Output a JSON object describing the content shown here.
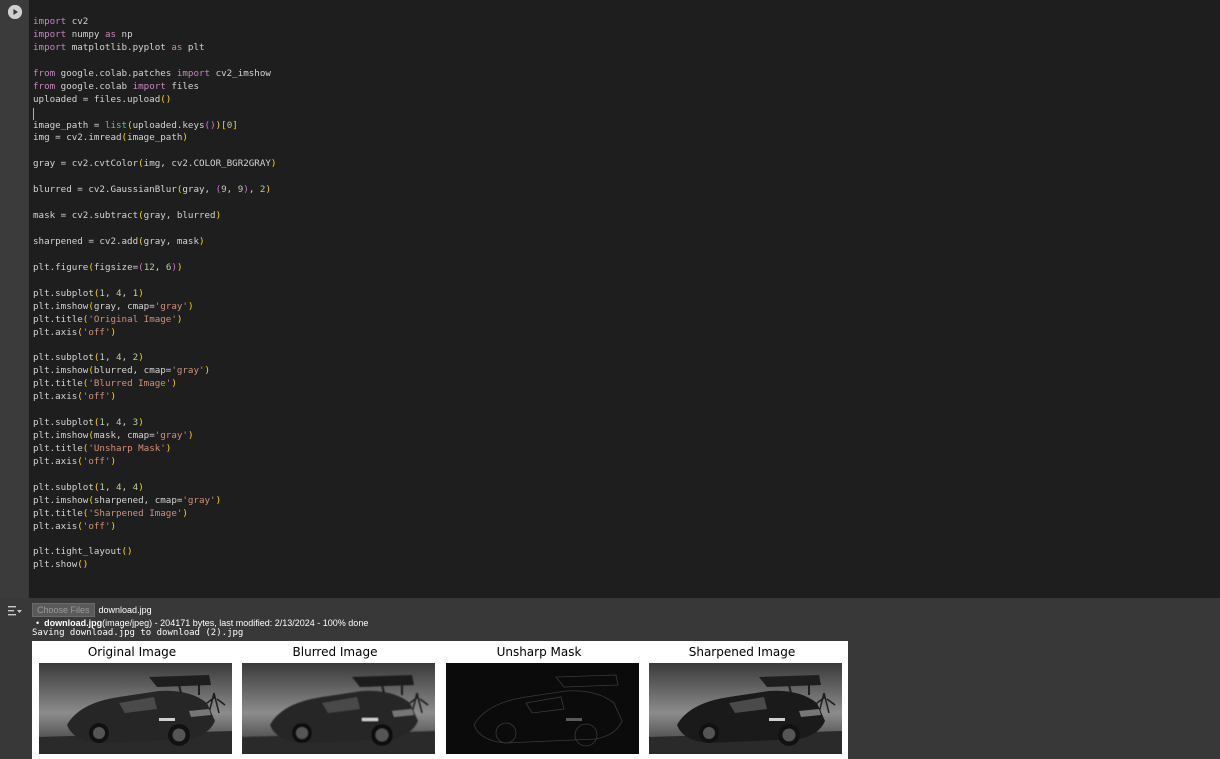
{
  "code_lines": [
    [
      {
        "t": "import",
        "c": "kw"
      },
      {
        "t": " cv2"
      }
    ],
    [
      {
        "t": "import",
        "c": "kw"
      },
      {
        "t": " numpy "
      },
      {
        "t": "as",
        "c": "kw"
      },
      {
        "t": " np"
      }
    ],
    [
      {
        "t": "import",
        "c": "kw"
      },
      {
        "t": " matplotlib.pyplot "
      },
      {
        "t": "as",
        "c": "kw"
      },
      {
        "t": " plt"
      }
    ],
    [],
    [
      {
        "t": "from",
        "c": "kw"
      },
      {
        "t": " google.colab.patches "
      },
      {
        "t": "import",
        "c": "kw"
      },
      {
        "t": " cv2_imshow"
      }
    ],
    [
      {
        "t": "from",
        "c": "kw"
      },
      {
        "t": " google.colab "
      },
      {
        "t": "import",
        "c": "kw"
      },
      {
        "t": " files"
      }
    ],
    [
      {
        "t": "uploaded = files.upload"
      },
      {
        "t": "()",
        "c": "p1"
      }
    ],
    [],
    [
      {
        "t": "image_path = "
      },
      {
        "t": "list",
        "c": "fn"
      },
      {
        "t": "(",
        "c": "p1"
      },
      {
        "t": "uploaded.keys"
      },
      {
        "t": "()",
        "c": "p2"
      },
      {
        "t": ")",
        "c": "p1"
      },
      {
        "t": "[",
        "c": "p1"
      },
      {
        "t": "0",
        "c": "num"
      },
      {
        "t": "]",
        "c": "p1"
      }
    ],
    [
      {
        "t": "img = cv2.imread"
      },
      {
        "t": "(",
        "c": "p1"
      },
      {
        "t": "image_path"
      },
      {
        "t": ")",
        "c": "p1"
      }
    ],
    [],
    [
      {
        "t": "gray = cv2.cvtColor"
      },
      {
        "t": "(",
        "c": "p1"
      },
      {
        "t": "img, cv2.COLOR_BGR2GRAY"
      },
      {
        "t": ")",
        "c": "p1"
      }
    ],
    [],
    [
      {
        "t": "blurred = cv2.GaussianBlur"
      },
      {
        "t": "(",
        "c": "p1"
      },
      {
        "t": "gray, "
      },
      {
        "t": "(",
        "c": "p2"
      },
      {
        "t": "9",
        "c": "num"
      },
      {
        "t": ", "
      },
      {
        "t": "9",
        "c": "num"
      },
      {
        "t": ")",
        "c": "p2"
      },
      {
        "t": ", "
      },
      {
        "t": "2",
        "c": "num"
      },
      {
        "t": ")",
        "c": "p1"
      }
    ],
    [],
    [
      {
        "t": "mask = cv2.subtract"
      },
      {
        "t": "(",
        "c": "p1"
      },
      {
        "t": "gray, blurred"
      },
      {
        "t": ")",
        "c": "p1"
      }
    ],
    [],
    [
      {
        "t": "sharpened = cv2.add"
      },
      {
        "t": "(",
        "c": "p1"
      },
      {
        "t": "gray, mask"
      },
      {
        "t": ")",
        "c": "p1"
      }
    ],
    [],
    [
      {
        "t": "plt.figure"
      },
      {
        "t": "(",
        "c": "p1"
      },
      {
        "t": "figsize="
      },
      {
        "t": "(",
        "c": "p2"
      },
      {
        "t": "12",
        "c": "num"
      },
      {
        "t": ", "
      },
      {
        "t": "6",
        "c": "num"
      },
      {
        "t": ")",
        "c": "p2"
      },
      {
        "t": ")",
        "c": "p1"
      }
    ],
    [],
    [
      {
        "t": "plt.subplot"
      },
      {
        "t": "(",
        "c": "p1"
      },
      {
        "t": "1",
        "c": "num"
      },
      {
        "t": ", "
      },
      {
        "t": "4",
        "c": "num"
      },
      {
        "t": ", "
      },
      {
        "t": "1",
        "c": "num"
      },
      {
        "t": ")",
        "c": "p1"
      }
    ],
    [
      {
        "t": "plt.imshow"
      },
      {
        "t": "(",
        "c": "p1"
      },
      {
        "t": "gray, cmap="
      },
      {
        "t": "'gray'",
        "c": "str"
      },
      {
        "t": ")",
        "c": "p1"
      }
    ],
    [
      {
        "t": "plt.title"
      },
      {
        "t": "(",
        "c": "p1"
      },
      {
        "t": "'Original Image'",
        "c": "str"
      },
      {
        "t": ")",
        "c": "p1"
      }
    ],
    [
      {
        "t": "plt.axis"
      },
      {
        "t": "(",
        "c": "p1"
      },
      {
        "t": "'off'",
        "c": "str"
      },
      {
        "t": ")",
        "c": "p1"
      }
    ],
    [],
    [
      {
        "t": "plt.subplot"
      },
      {
        "t": "(",
        "c": "p1"
      },
      {
        "t": "1",
        "c": "num"
      },
      {
        "t": ", "
      },
      {
        "t": "4",
        "c": "num"
      },
      {
        "t": ", "
      },
      {
        "t": "2",
        "c": "num"
      },
      {
        "t": ")",
        "c": "p1"
      }
    ],
    [
      {
        "t": "plt.imshow"
      },
      {
        "t": "(",
        "c": "p1"
      },
      {
        "t": "blurred, cmap="
      },
      {
        "t": "'gray'",
        "c": "str"
      },
      {
        "t": ")",
        "c": "p1"
      }
    ],
    [
      {
        "t": "plt.title"
      },
      {
        "t": "(",
        "c": "p1"
      },
      {
        "t": "'Blurred Image'",
        "c": "str"
      },
      {
        "t": ")",
        "c": "p1"
      }
    ],
    [
      {
        "t": "plt.axis"
      },
      {
        "t": "(",
        "c": "p1"
      },
      {
        "t": "'off'",
        "c": "str"
      },
      {
        "t": ")",
        "c": "p1"
      }
    ],
    [],
    [
      {
        "t": "plt.subplot"
      },
      {
        "t": "(",
        "c": "p1"
      },
      {
        "t": "1",
        "c": "num"
      },
      {
        "t": ", "
      },
      {
        "t": "4",
        "c": "num"
      },
      {
        "t": ", "
      },
      {
        "t": "3",
        "c": "num"
      },
      {
        "t": ")",
        "c": "p1"
      }
    ],
    [
      {
        "t": "plt.imshow"
      },
      {
        "t": "(",
        "c": "p1"
      },
      {
        "t": "mask, cmap="
      },
      {
        "t": "'gray'",
        "c": "str"
      },
      {
        "t": ")",
        "c": "p1"
      }
    ],
    [
      {
        "t": "plt.title"
      },
      {
        "t": "(",
        "c": "p1"
      },
      {
        "t": "'Unsharp Mask'",
        "c": "str"
      },
      {
        "t": ")",
        "c": "p1"
      }
    ],
    [
      {
        "t": "plt.axis"
      },
      {
        "t": "(",
        "c": "p1"
      },
      {
        "t": "'off'",
        "c": "str"
      },
      {
        "t": ")",
        "c": "p1"
      }
    ],
    [],
    [
      {
        "t": "plt.subplot"
      },
      {
        "t": "(",
        "c": "p1"
      },
      {
        "t": "1",
        "c": "num"
      },
      {
        "t": ", "
      },
      {
        "t": "4",
        "c": "num"
      },
      {
        "t": ", "
      },
      {
        "t": "4",
        "c": "num"
      },
      {
        "t": ")",
        "c": "p1"
      }
    ],
    [
      {
        "t": "plt.imshow"
      },
      {
        "t": "(",
        "c": "p1"
      },
      {
        "t": "sharpened, cmap="
      },
      {
        "t": "'gray'",
        "c": "str"
      },
      {
        "t": ")",
        "c": "p1"
      }
    ],
    [
      {
        "t": "plt.title"
      },
      {
        "t": "(",
        "c": "p1"
      },
      {
        "t": "'Sharpened Image'",
        "c": "str"
      },
      {
        "t": ")",
        "c": "p1"
      }
    ],
    [
      {
        "t": "plt.axis"
      },
      {
        "t": "(",
        "c": "p1"
      },
      {
        "t": "'off'",
        "c": "str"
      },
      {
        "t": ")",
        "c": "p1"
      }
    ],
    [],
    [
      {
        "t": "plt.tight_layout"
      },
      {
        "t": "()",
        "c": "p1"
      }
    ],
    [
      {
        "t": "plt.show"
      },
      {
        "t": "()",
        "c": "p1"
      }
    ]
  ],
  "output": {
    "choose_files_label": "Choose Files",
    "selected_file": "download.jpg",
    "upload_status": {
      "file_name": "download.jpg",
      "details": "(image/jpeg) - 204171 bytes, last modified: 2/13/2024 - 100% done"
    },
    "saving_text": "Saving download.jpg to download (2).jpg"
  },
  "figure": {
    "panels": [
      {
        "title": "Original Image",
        "kind": "gray"
      },
      {
        "title": "Blurred Image",
        "kind": "blurred"
      },
      {
        "title": "Unsharp Mask",
        "kind": "mask"
      },
      {
        "title": "Sharpened Image",
        "kind": "sharpened"
      }
    ]
  },
  "icons": {
    "run": "play-circle-icon",
    "output_toggle": "output-collapse-icon"
  }
}
